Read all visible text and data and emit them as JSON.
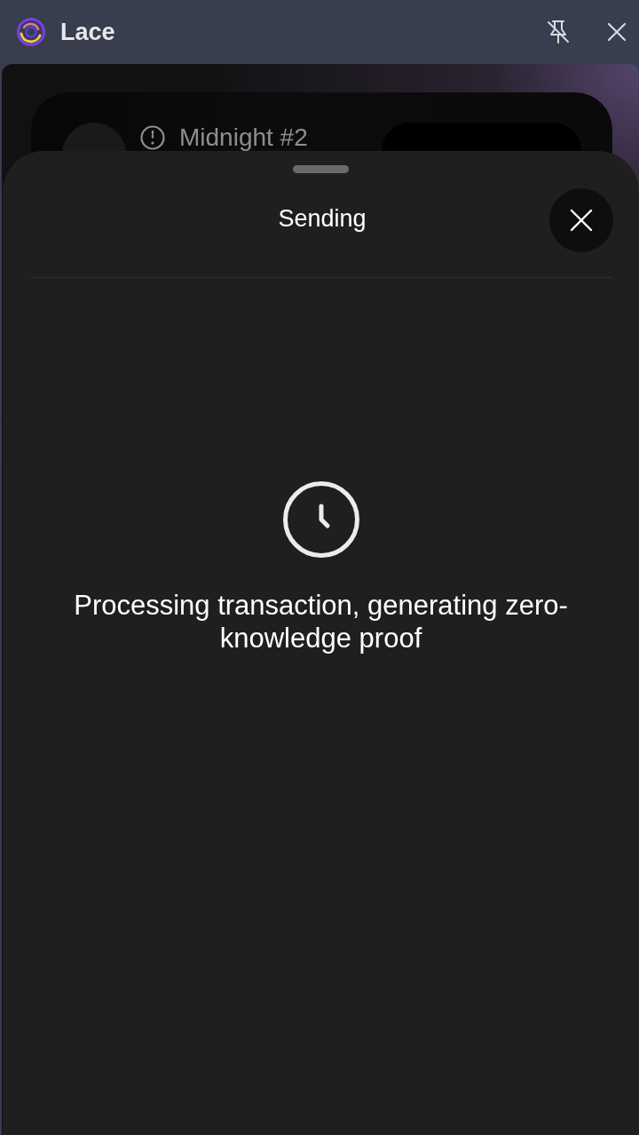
{
  "window": {
    "title": "Lace"
  },
  "wallet_card": {
    "wallet_name": "Midnight #2"
  },
  "sheet": {
    "title": "Sending",
    "message": "Processing transaction, generating zero-knowledge proof"
  }
}
